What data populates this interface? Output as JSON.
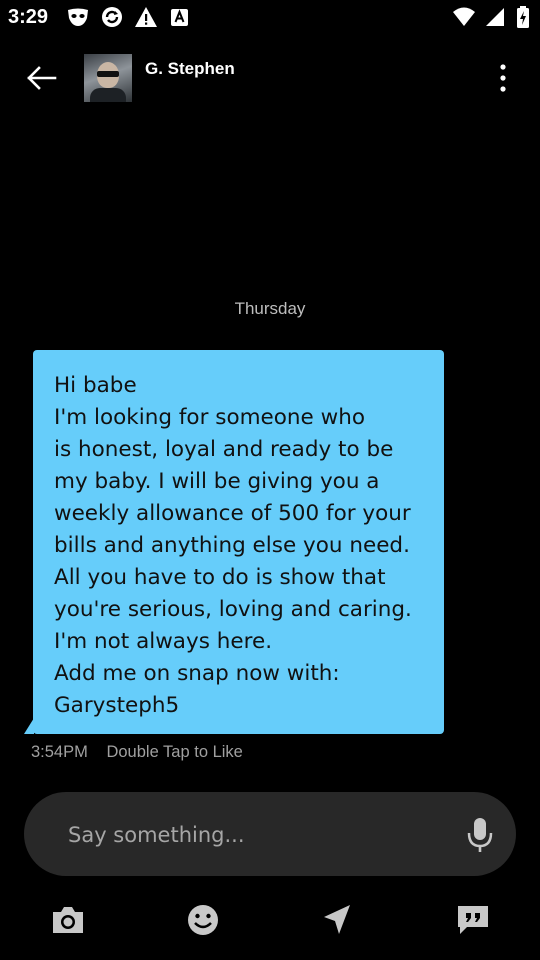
{
  "status_bar": {
    "time": "3:29",
    "left_icons": [
      "grindr-mask-icon",
      "sync-icon",
      "warning-icon",
      "translate-icon"
    ],
    "right_icons": [
      "wifi-icon",
      "cell-signal-icon",
      "battery-charging-icon"
    ]
  },
  "header": {
    "contact_name": "G. Stephen",
    "back_icon": "arrow-left-icon",
    "menu_icon": "more-vert-icon"
  },
  "conversation": {
    "day_label": "Thursday",
    "message": {
      "lines": [
        "Hi babe",
        "I'm looking for someone who",
        "is honest, loyal and ready to be",
        "my baby. I will be giving you a",
        "weekly allowance of 500 for your",
        "bills and anything else you need.",
        "All you have to do is show that",
        "you're serious, loving and caring.",
        "I'm not always here.",
        "Add me on snap now with:",
        "Garysteph5"
      ],
      "time": "3:54PM",
      "hint": "Double Tap to Like"
    }
  },
  "composer": {
    "placeholder": "Say something...",
    "mic_icon": "microphone-icon"
  },
  "toolbar": {
    "icons": [
      "camera-icon",
      "emoji-icon",
      "send-location-icon",
      "saved-phrases-icon"
    ]
  },
  "colors": {
    "background": "#000000",
    "bubble": "#66cdfa",
    "input_bg": "#282828",
    "meta_text": "#a0a0a0"
  }
}
